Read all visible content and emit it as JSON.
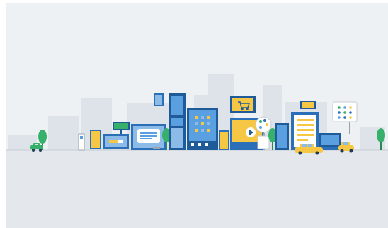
{
  "scene": {
    "subject": "city-skyline-of-device-buildings",
    "colors": {
      "background": "#eef1f4",
      "ground": "#e4e8ec",
      "ghost_building": "#dde3e9",
      "primary_blue": "#2a6fb7",
      "dark_blue": "#1f5a99",
      "light_blue": "#8dbbe8",
      "sky_blue": "#5aa0e0",
      "yellow": "#f6c744",
      "green": "#36b06a",
      "white": "#ffffff",
      "gray": "#9aa4ad"
    },
    "icons": [
      "tree-icon",
      "car-icon",
      "taxi-icon",
      "shopping-cart-icon",
      "play-icon",
      "palette-icon",
      "app-grid-icon",
      "chat-bubble-icon"
    ]
  }
}
